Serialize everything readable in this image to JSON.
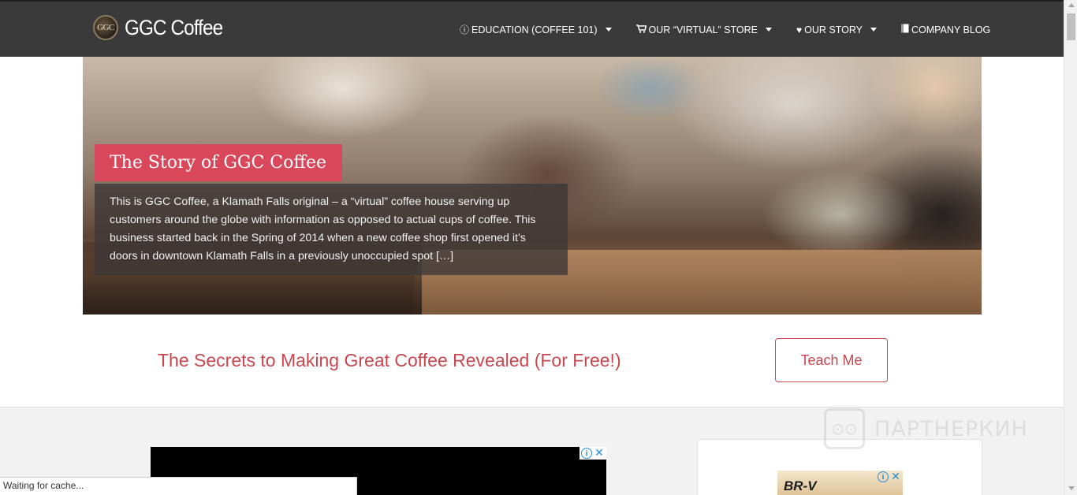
{
  "nav": {
    "brand_logo": "GGC",
    "brand_name": "GGC Coffee",
    "items": [
      {
        "icon": "info-circle-icon",
        "glyph": "ⓘ",
        "label": "EDUCATION (COFFEE 101)",
        "dropdown": true
      },
      {
        "icon": "shopping-cart-icon",
        "glyph": "🛒",
        "label": "OUR “VIRTUAL” STORE",
        "dropdown": true
      },
      {
        "icon": "heart-icon",
        "glyph": "♥",
        "label": "OUR STORY",
        "dropdown": true
      },
      {
        "icon": "book-icon",
        "glyph": "▮",
        "label": "COMPANY BLOG",
        "dropdown": false
      }
    ]
  },
  "hero": {
    "title": "The Story of GGC Coffee",
    "excerpt": "This is GGC Coffee, a Klamath Falls original – a “virtual” coffee house serving up customers around the globe with information as opposed to actual cups of coffee. This business started back in the Spring of 2014 when a new coffee shop first opened it’s doors in downtown Klamath Falls in a previously unoccupied spot […]"
  },
  "cta": {
    "text": "The Secrets to Making Great Coffee Revealed (For Free!)",
    "button": "Teach Me"
  },
  "ads": {
    "info_glyph": "i",
    "close_glyph": "✕",
    "right_brand": "BR-V"
  },
  "watermark": {
    "text": "ПАРТНЕРКИН"
  },
  "status_bar": {
    "text": "Waiting for cache..."
  },
  "colors": {
    "accent": "#c8474f",
    "title_box": "#d9475a",
    "navbar": "#3a3a3a"
  }
}
